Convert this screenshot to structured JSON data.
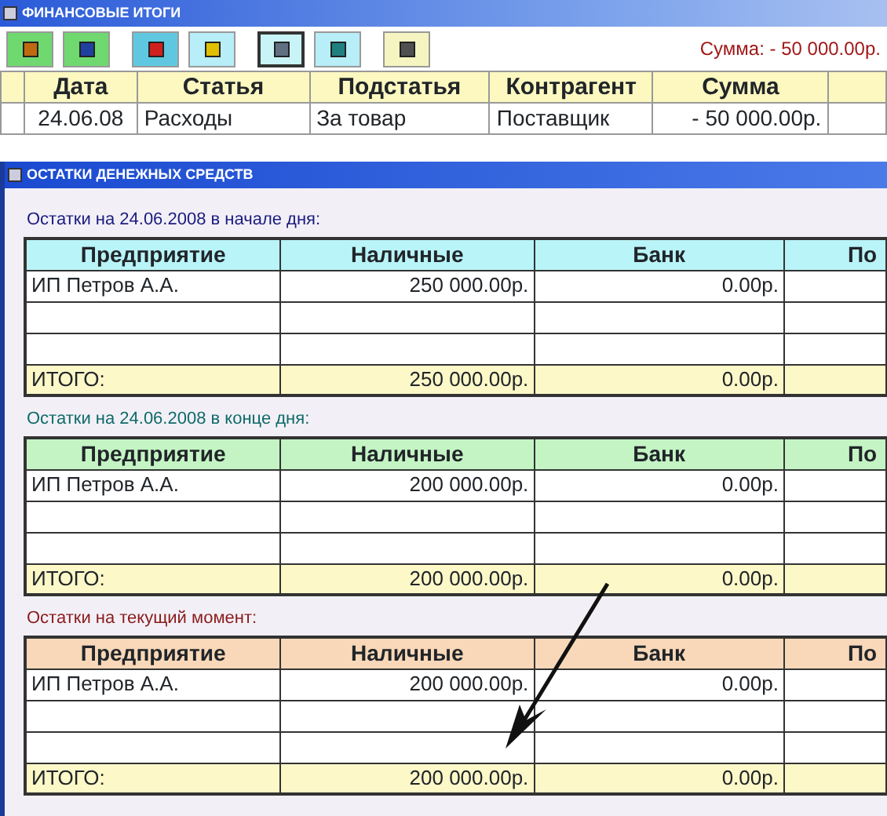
{
  "window": {
    "title": "ФИНАНСОВЫЕ ИТОГИ"
  },
  "toolbar": {
    "buttons": [
      {
        "color": "#6fd86f",
        "pressed": false
      },
      {
        "color": "#6fd86f",
        "pressed": false
      },
      {
        "color": "#5fc8e0",
        "pressed": false
      },
      {
        "color": "#b8eef8",
        "pressed": false
      },
      {
        "color": "#c8f4f8",
        "pressed": true
      },
      {
        "color": "#b8eef8",
        "pressed": false
      },
      {
        "color": "#f6f4c0",
        "pressed": false
      }
    ],
    "total": "Сумма: -  50 000.00р."
  },
  "table": {
    "columns": [
      "Дата",
      "Статья",
      "Подстатья",
      "Контрагент",
      "Сумма"
    ],
    "rows": [
      {
        "cells": [
          "24.06.08",
          "Расходы",
          "За товар",
          "Поставщик",
          "-  50 000.00р."
        ]
      }
    ]
  },
  "balances_window": {
    "title": "ОСТАТКИ ДЕНЕЖНЫХ СРЕДСТВ",
    "sections": [
      {
        "title": "Остатки на 24.06.2008 в начале дня:",
        "color": "#1a1a80",
        "header": {
          "color": "#b8f4f8",
          "columns": [
            "Предприятие",
            "Наличные",
            "Банк",
            "По"
          ]
        },
        "rows": [
          [
            "ИП Петров А.А.",
            "250 000.00р.",
            "0.00р."
          ]
        ],
        "total": [
          "ИТОГО:",
          "250 000.00р.",
          "0.00р."
        ]
      },
      {
        "title": "Остатки на 24.06.2008 в конце дня:",
        "color": "#0f6a6a",
        "header": {
          "color": "#c4f4c4",
          "columns": [
            "Предприятие",
            "Наличные",
            "Банк",
            "По"
          ]
        },
        "rows": [
          [
            "ИП Петров А.А.",
            "200 000.00р.",
            "0.00р."
          ]
        ],
        "total": [
          "ИТОГО:",
          "200 000.00р.",
          "0.00р."
        ]
      },
      {
        "title": "Остатки на текущий момент:",
        "color": "#8a1a1a",
        "header": {
          "color": "#f8d8b8",
          "columns": [
            "Предприятие",
            "Наличные",
            "Банк",
            "По"
          ]
        },
        "rows": [
          [
            "ИП Петров А.А.",
            "200 000.00р.",
            "0.00р."
          ]
        ],
        "total": [
          "ИТОГО:",
          "200 000.00р.",
          "0.00р."
        ]
      }
    ]
  }
}
